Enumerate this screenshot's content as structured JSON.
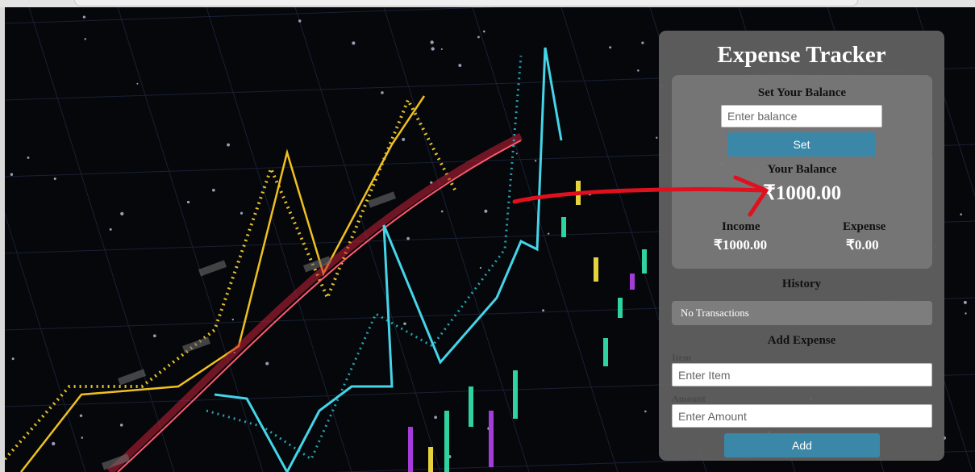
{
  "app": {
    "title": "Expense Tracker",
    "set_balance_label": "Set Your Balance",
    "balance_placeholder": "Enter balance",
    "set_button": "Set",
    "your_balance_label": "Your Balance",
    "balance_value": "₹1000.00",
    "income_label": "Income",
    "income_value": "₹1000.00",
    "expense_label": "Expense",
    "expense_value": "₹0.00",
    "history_label": "History",
    "history_empty": "No Transactions",
    "add_expense_label": "Add Expense",
    "item_label": "Item",
    "item_placeholder": "Enter Item",
    "amount_label": "Amount",
    "amount_placeholder": "Enter Amount",
    "add_button": "Add"
  },
  "colors": {
    "button": "#3b87a8",
    "panel": "#626262",
    "annotation_arrow": "#e0101e"
  }
}
